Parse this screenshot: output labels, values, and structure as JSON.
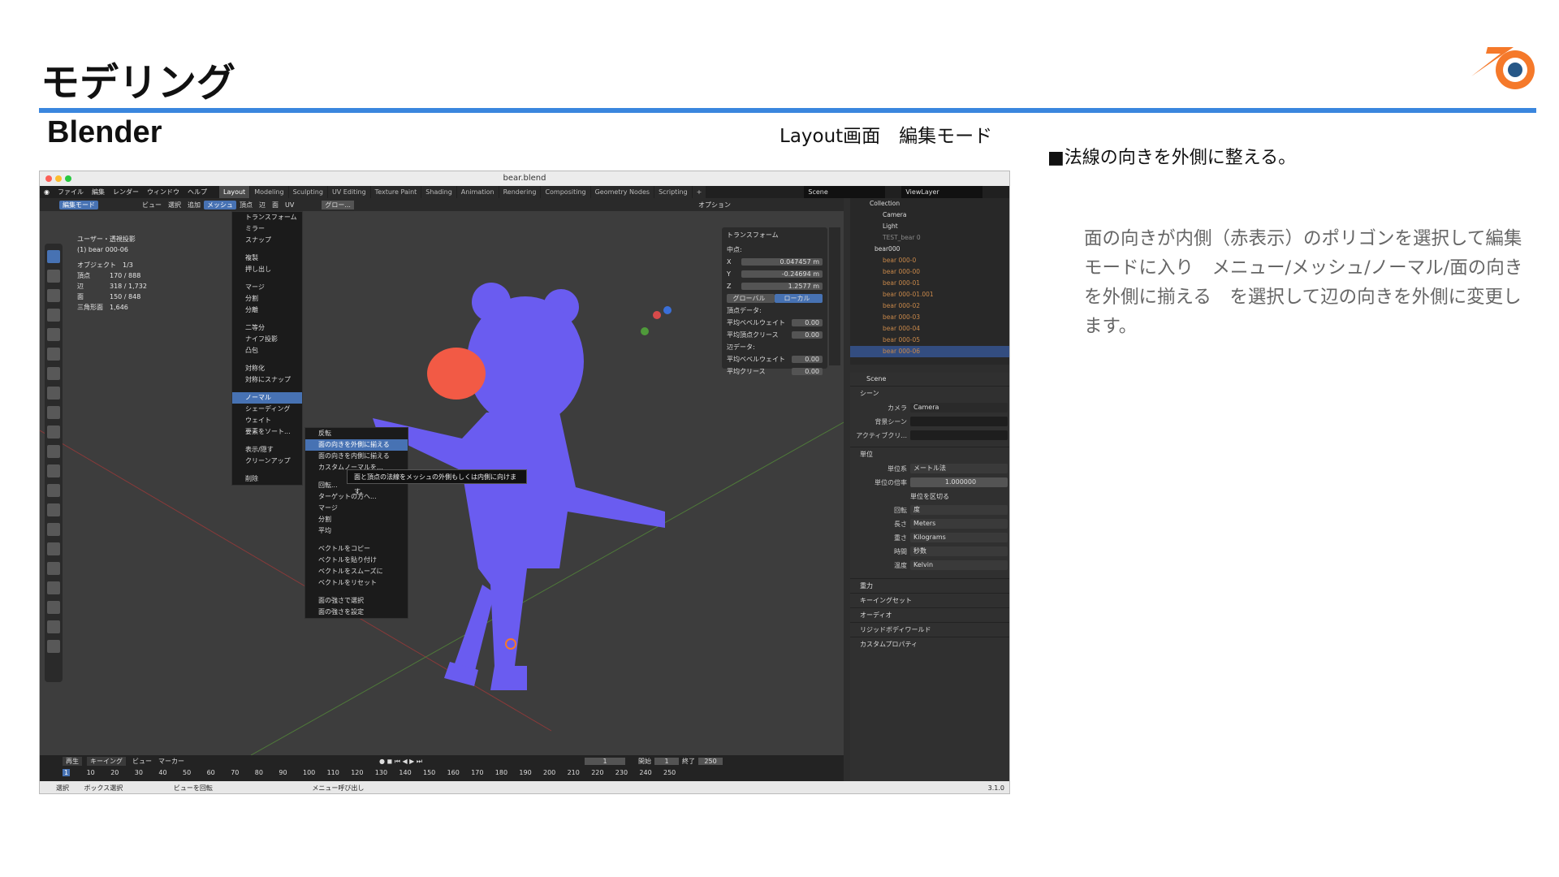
{
  "slide": {
    "heading": "モデリング",
    "subtitle": "Blender",
    "caption": "Layout画面　編集モード",
    "note_title": "■法線の向きを外側に整える。",
    "note_body": "面の向きが内側（赤表示）のポリゴンを選択して編集モードに入り　メニュー/メッシュ/ノーマル/面の向きを外側に揃える　を選択して辺の向きを外側に変更します。"
  },
  "colors": {
    "accent_rule": "#3a86de",
    "logo_orange": "#f5792a",
    "logo_blue": "#265787",
    "mesh_blue": "#6a5cf0",
    "mesh_red": "#f25a45"
  },
  "screenshot": {
    "window_title": "bear.blend",
    "menubar": [
      "ファイル",
      "編集",
      "レンダー",
      "ウィンドウ",
      "ヘルプ"
    ],
    "workspaces": [
      "Layout",
      "Modeling",
      "Sculpting",
      "UV Editing",
      "Texture Paint",
      "Shading",
      "Animation",
      "Rendering",
      "Compositing",
      "Geometry Nodes",
      "Scripting"
    ],
    "scene": "Scene",
    "view_layer": "ViewLayer",
    "header": {
      "mode": "編集モード",
      "items": [
        "ビュー",
        "選択",
        "追加",
        "メッシュ",
        "頂点",
        "辺",
        "面",
        "UV"
      ],
      "orientation": "グロー..."
    },
    "stats": {
      "view": "ユーザー・透視投影",
      "object": "(1) bear 000-06",
      "lines": [
        "オブジェクト　1/3",
        "頂点　　　170 / 888",
        "辺　　　　318 / 1,732",
        "面　　　　150 / 848",
        "三角形面　1,646"
      ]
    },
    "mesh_menu": [
      "トランスフォーム",
      "ミラー",
      "スナップ",
      "複製",
      "押し出し",
      "マージ",
      "分割",
      "分離",
      "二等分",
      "ナイフ投影",
      "凸包",
      "対称化",
      "対称にスナップ",
      "ノーマル",
      "シェーディング",
      "ウェイト",
      "要素をソート...",
      "表示/隠す",
      "クリーンアップ",
      "削除"
    ],
    "normals_menu": [
      "反転",
      "面の向きを外側に揃える",
      "面の向きを内側に揃える",
      "カスタムノーマルを…",
      "回転...",
      "ターゲットの方へ...",
      "マージ",
      "分割",
      "平均",
      "ベクトルをコピー",
      "ベクトルを貼り付け",
      "ベクトルをスムーズに",
      "ベクトルをリセット",
      "面の強さで選択",
      "面の強さを設定"
    ],
    "tooltip": "面と頂点の法線をメッシュの外側もしくは内側に向けます。",
    "n_panel": {
      "title": "トランスフォーム",
      "median": "中点:",
      "x": "0.047457 m",
      "y": "-0.24694 m",
      "z": "1.2577 m",
      "global": "グローバル",
      "local": "ローカル",
      "vertex_data": "頂点データ:",
      "bevel_weight": "平均ベベルウェイト",
      "bevel_weight_val": "0.00",
      "crease": "平均頂点クリース",
      "crease_val": "0.00",
      "edge_data": "辺データ:",
      "edge_bevel": "平均ベベルウェイト",
      "edge_bevel_val": "0.00",
      "edge_crease": "平均クリース",
      "edge_crease_val": "0.00",
      "options": "オプション"
    },
    "outliner": [
      "Collection",
      "Camera",
      "Light",
      "TEST_bear 0",
      "bear000",
      "bear 000-0",
      "bear 000-00",
      "bear 000-01",
      "bear 000-01.001",
      "bear 000-02",
      "bear 000-03",
      "bear 000-04",
      "bear 000-05",
      "bear 000-06"
    ],
    "properties": {
      "scene_label": "Scene",
      "section": "シーン",
      "camera_label": "カメラ",
      "camera": "Camera",
      "bg_scene": "背景シーン",
      "active_clip": "アクティブクリ...",
      "units_section": "単位",
      "unit_system_label": "単位系",
      "unit_system": "メートル法",
      "unit_scale_label": "単位の倍率",
      "unit_scale": "1.000000",
      "separate_units": "単位を区切る",
      "rotation_label": "回転",
      "rotation": "度",
      "length_label": "長さ",
      "length": "Meters",
      "mass_label": "重さ",
      "mass": "Kilograms",
      "time_label": "時間",
      "time": "秒数",
      "temp_label": "温度",
      "temp": "Kelvin",
      "more": [
        "重力",
        "キーイングセット",
        "オーディオ",
        "リジッドボディワールド",
        "カスタムプロパティ"
      ]
    },
    "timeline": {
      "play": "再生",
      "keying": "キーイング",
      "view": "ビュー",
      "marker": "マーカー",
      "frame": "1",
      "start_label": "開始",
      "start": "1",
      "end_label": "終了",
      "end": "250",
      "ticks": [
        "1",
        "10",
        "20",
        "30",
        "40",
        "50",
        "60",
        "70",
        "80",
        "90",
        "100",
        "110",
        "120",
        "130",
        "140",
        "150",
        "160",
        "170",
        "180",
        "190",
        "200",
        "210",
        "220",
        "230",
        "240",
        "250"
      ]
    },
    "status": {
      "select": "選択",
      "box": "ボックス選択",
      "rotate": "ビューを回転",
      "menu": "メニュー呼び出し",
      "version": "3.1.0"
    }
  }
}
